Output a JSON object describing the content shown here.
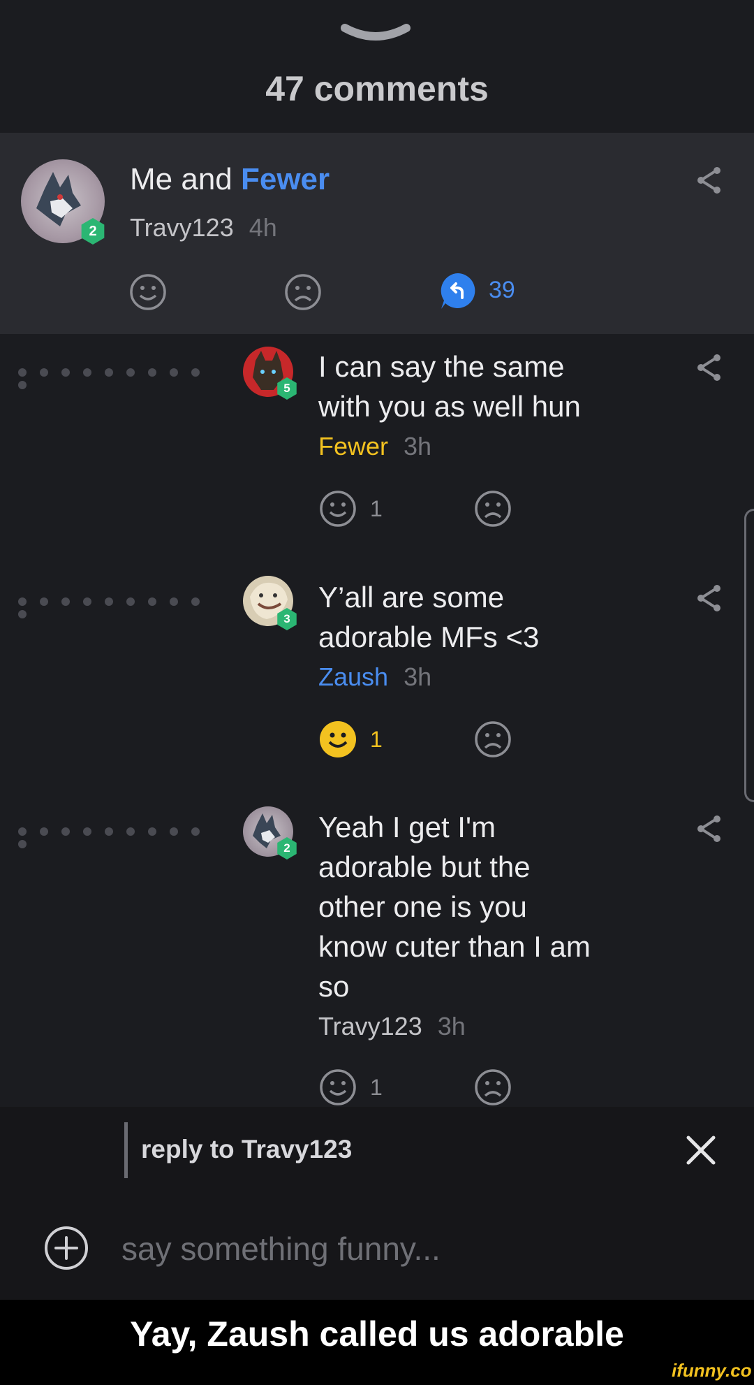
{
  "header": {
    "comment_count": "47 comments"
  },
  "main_comment": {
    "text_prefix": "Me and ",
    "text_mention": "Fewer",
    "author": "Travy123",
    "time": "4h",
    "badge_level": "2",
    "reply_count": "39"
  },
  "replies": [
    {
      "lines": [
        "I can say the same",
        "with you as well hun"
      ],
      "author": "Fewer",
      "author_color": "#f3c220",
      "time": "3h",
      "badge_level": "5",
      "like_count": "1",
      "liked": false
    },
    {
      "lines": [
        "Y’all are some",
        "adorable MFs <3"
      ],
      "author": "Zaush",
      "author_color": "#4a8df0",
      "time": "3h",
      "badge_level": "3",
      "like_count": "1",
      "liked": true
    },
    {
      "lines": [
        "Yeah I get I'm",
        "adorable but the",
        "other one is you",
        "know cuter than I am",
        "so"
      ],
      "author": "Travy123",
      "author_color": "#c4c4c8",
      "time": "3h",
      "badge_level": "2",
      "like_count": "1",
      "liked": false
    }
  ],
  "reply_bar": {
    "reply_to": "reply to Travy123",
    "placeholder": "say something funny..."
  },
  "caption": "Yay, Zaush called us adorable",
  "watermark": "ifunny.co",
  "colors": {
    "accent_blue": "#4a8df0",
    "liked_yellow": "#f3c220",
    "badge_green": "#2bb673"
  },
  "icons": [
    "chevron-down-icon",
    "share-icon",
    "smile-icon",
    "frown-icon",
    "reply-bubble-icon",
    "close-icon",
    "plus-icon"
  ]
}
